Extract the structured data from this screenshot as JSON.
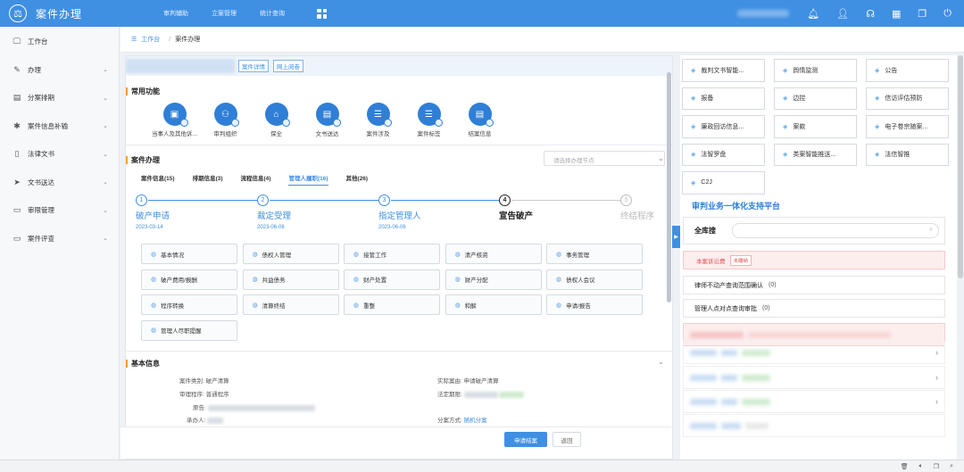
{
  "app": {
    "title": "案件办理",
    "logo_icon": "court-emblem-icon"
  },
  "topnav": {
    "items": [
      "审判辅助",
      "立案管理",
      "统计查询"
    ]
  },
  "top_icons": [
    "bell-icon",
    "user-icon",
    "headset-icon",
    "calendar-icon",
    "window-icon",
    "close-icon"
  ],
  "sidebar": {
    "items": [
      {
        "label": "工作台",
        "icon": "monitor-icon",
        "chevron": false
      },
      {
        "label": "办理",
        "icon": "edit-icon",
        "chevron": true
      },
      {
        "label": "分案排期",
        "icon": "calendar-icon",
        "chevron": true
      },
      {
        "label": "案件信息补输",
        "icon": "gear-icon",
        "chevron": true
      },
      {
        "label": "法律文书",
        "icon": "book-icon",
        "chevron": true
      },
      {
        "label": "文书送达",
        "icon": "send-icon",
        "chevron": true
      },
      {
        "label": "审限管理",
        "icon": "folder-icon",
        "chevron": true
      },
      {
        "label": "案件评查",
        "icon": "folder-icon",
        "chevron": true
      }
    ]
  },
  "breadcrumb": {
    "home": "工作台",
    "current": "案件办理"
  },
  "case_header": {
    "detail_btn": "案件详情",
    "online_btn": "网上阅卷"
  },
  "common_functions": {
    "title": "常用功能",
    "items": [
      "当事人及其他诉...",
      "审判组织",
      "保全",
      "文书送达",
      "案件涉及",
      "案件标签",
      "结案信息"
    ]
  },
  "case_handling": {
    "title": "案件办理",
    "stage_placeholder": "请选择办理节点",
    "tabs": [
      {
        "label": "案件信息(15)",
        "active": false
      },
      {
        "label": "排期信息(3)",
        "active": false
      },
      {
        "label": "流程信息(4)",
        "active": false
      },
      {
        "label": "管理人履职(16)",
        "active": true
      },
      {
        "label": "其他(26)",
        "active": false
      }
    ],
    "steps": [
      {
        "num": "1",
        "name": "破产申请",
        "date": "2023-03-14",
        "state": "done"
      },
      {
        "num": "2",
        "name": "裁定受理",
        "date": "2023-06-06",
        "state": "done"
      },
      {
        "num": "3",
        "name": "指定管理人",
        "date": "2023-06-06",
        "state": "done"
      },
      {
        "num": "4",
        "name": "宣告破产",
        "date": "",
        "state": "current"
      },
      {
        "num": "5",
        "name": "终结程序",
        "date": "",
        "state": "todo"
      }
    ],
    "operations": [
      "基本情况",
      "债权人管理",
      "接管工作",
      "清产核资",
      "事务管理",
      "破产费用/报酬",
      "共益债务",
      "财产处置",
      "财产分配",
      "债权人会议",
      "程序转换",
      "清算终结",
      "重整",
      "和解",
      "申请/报告",
      "管理人尽职提醒"
    ]
  },
  "basic_info": {
    "title": "基本信息",
    "fields": {
      "case_type_label": "案件类别:",
      "case_type_value": "破产清算",
      "procedure_label": "审理程序:",
      "procedure_value": "普通程序",
      "plaintiff_label": "原告:",
      "handler_label": "承办人:",
      "cause_label": "实际案由:",
      "cause_value": "申请破产清算",
      "deadline_label": "法定期限:",
      "assign_label": "分案方式:",
      "assign_value": "随机分案"
    }
  },
  "footer": {
    "submit": "申请结案",
    "back": "返回"
  },
  "right_panel": {
    "quick_links": [
      "裁判文书智能...",
      "舆情监测",
      "公告",
      "报备",
      "边控",
      "信访评估预防",
      "廉政回访信息...",
      "案款",
      "电子卷宗随案...",
      "法智罗盘",
      "类案智能推送...",
      "法信智推",
      "C2J"
    ],
    "platform_title": "审判业务一体化支持平台",
    "search_label": "全库搜",
    "alert_text": "本案诉讼费",
    "alert_chip": "未缴纳",
    "rows": [
      {
        "label": "律师不动产查询范围确认",
        "count": "(0)"
      },
      {
        "label": "管理人点对点查询审批",
        "count": "(0)"
      }
    ]
  },
  "colors": {
    "brand": "#3f8fe3",
    "accent": "#f0a030",
    "alert": "#e05050"
  }
}
